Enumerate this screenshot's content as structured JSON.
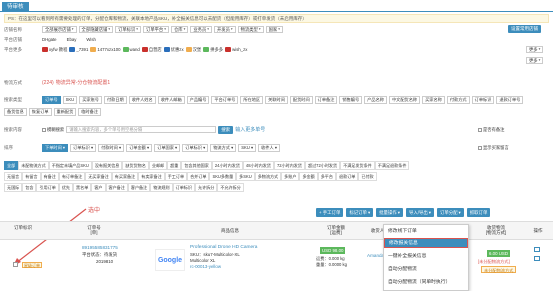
{
  "tabs": {
    "active": "待审核"
  },
  "tip": "PS：在这里可以看到所有需要处理的订单，分配仓库和物流，关联本地产品SKU，补全报关信息可以去配货（但能用库存）或打单发货（未启用库存）",
  "filters": {
    "store_label": "店铺名称",
    "store_buttons": [
      "全部展示店铺",
      "全部隐藏店铺",
      "订单标识",
      "订单平台",
      "仓库",
      "业务员",
      "开发员",
      "物流类型",
      "国家",
      "设置常用店铺"
    ],
    "platform_label": "平台店铺",
    "platforms": [
      "DHgate",
      "Ebay",
      "Wish"
    ],
    "platform_more": "平台更多",
    "stores": [
      "xyfw 教程",
      "_7391",
      "1477xzx100",
      "wand",
      "自营店",
      "优惠zx",
      "汉堡",
      "拼多多",
      "wish_zx"
    ],
    "more": "更多",
    "logistics_label": "物流方式",
    "logistics_prefix": "(224)",
    "logistics_value": "物流异常-分仓物流配置1",
    "search_type_label": "搜索类型",
    "search_types": [
      "订单号",
      "SKU",
      "买家账号",
      "付款日期",
      "收件人姓名",
      "收件人邮箱",
      "产品编号",
      "平台订单号",
      "所在地区",
      "关联时间",
      "配货时间",
      "订单备注",
      "销售编号",
      "产品名称",
      "中文配货名称",
      "买家名称",
      "付款方式",
      "订单标识",
      "退款订单号",
      "备货信息",
      "恢复订单",
      "重新配货",
      "临时备注"
    ],
    "search_content_label": "搜索内容",
    "fuzzy": "模糊搜索",
    "search_placeholder": "请输入搜索内容，多个单号用空格分隔",
    "search_btn": "搜索",
    "advanced": "输入更多单号",
    "filter_no_remark": "是否有备注",
    "sort_label": "排序",
    "sort_buttons": [
      "下单时间",
      "订单标识",
      "付款时间",
      "订单金额",
      "订单国家",
      "订单标识",
      "物流方式",
      "SKU",
      "收件人"
    ],
    "sort_check": "显示买家留言"
  },
  "status_row1": [
    "全部",
    "未配物流方式",
    "不指定未填产品SKU",
    "没有报关信息",
    "缺货货物名",
    "业邮邮",
    "超重",
    "包含其他国家",
    "24小时内发货",
    "48小时内发货",
    "72小时内发货",
    "超过72小时发货",
    "不满足发货条件",
    "不满足退款条件"
  ],
  "status_row2": [
    "无留言",
    "有留言",
    "有备注",
    "有订单备注",
    "无买家备注",
    "有买家备注",
    "有卖家备注",
    "手工订单",
    "合并订单",
    "SKU多数量",
    "多SKU",
    "多物流方式",
    "多账户",
    "多金额",
    "多平台",
    "退款订单",
    "已付款"
  ],
  "status_row3": [
    "无国际",
    "包含",
    "引用订单",
    "优先",
    "黑名单",
    "客户",
    "客户备注",
    "客户备注",
    "物流规则",
    "订单标识",
    "允许拆分",
    "不允许拆分"
  ],
  "toolbar": {
    "arrow_label": "选中",
    "manual_order": "+ 手工订单",
    "mark_order": "标记订单",
    "batch": "批量操作",
    "export": "导入/导出",
    "order_dispatch": "订单分配",
    "fetch": "抓取订单"
  },
  "table": {
    "headers": [
      "订单标识",
      "订单号\n[单]",
      "商品信息",
      "订单金额\n[运费]",
      "收货人信息",
      "收货物流\n[物流方式]",
      "操作"
    ]
  },
  "row": {
    "order_no": "89195585831775",
    "platform": "平台状态：待发货",
    "date": "2019810",
    "product": "Professional Drone HD Camera",
    "sku": "SKU：sku7-Multicolor-XL",
    "color": "Multicolor XL",
    "variant": "rc-00013-yellow",
    "amount": "USD 98.00",
    "shipping": "运费：0.000 kg",
    "weight": "重量：0.0000 kg",
    "buyer": "Amanda D.",
    "logistics_amt": "6.00 USD",
    "logistics_badge": "[未分配物流方式]",
    "logistics_sub": "未分配物流方式",
    "tag": "选中",
    "tag_badge": "星级订单"
  },
  "menu": {
    "items": [
      "修改线下订单",
      "修改报关信息",
      "一键补全报关信息",
      "自动分配物流",
      "自动分配物流（同单时执行）"
    ]
  }
}
